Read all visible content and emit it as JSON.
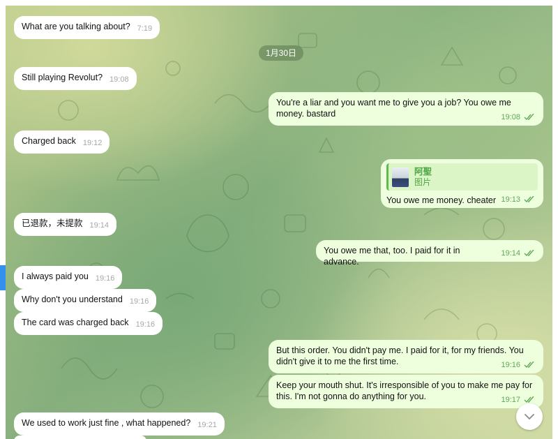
{
  "date_divider": "1月30日",
  "incoming": [
    {
      "text": "What are you talking about?",
      "time": "7:19"
    },
    {
      "text": "Still playing Revolut?",
      "time": "19:08"
    },
    {
      "text": "Charged back",
      "time": "19:12"
    },
    {
      "text": "已退款，未提款",
      "time": "19:14"
    },
    {
      "text": "I always paid you",
      "time": "19:16"
    },
    {
      "text": "Why don't you understand",
      "time": "19:16"
    },
    {
      "text": "The card was charged back",
      "time": "19:16"
    },
    {
      "text": "We used to work just fine , what happened?",
      "time": "19:21"
    }
  ],
  "outgoing": [
    {
      "text": "You're a liar and you want me to give you a job? You owe me money. bastard",
      "time": "19:08"
    },
    {
      "text": "You owe me money. cheater",
      "time": "19:13",
      "reply_name": "阿聖",
      "reply_sub": "图片"
    },
    {
      "text": "You owe me that, too. I paid for it in advance.",
      "time": "19:14"
    },
    {
      "text": "But this order. You didn't pay me. I paid for it, for my friends. You didn't give it to me the first time.",
      "time": "19:16"
    },
    {
      "text": "Keep your mouth shut. It's irresponsible of you to make me pay for this. I'm not gonna do anything for you.",
      "time": "19:17"
    }
  ],
  "colors": {
    "incoming_bubble": "#ffffff",
    "outgoing_bubble": "#eeffde",
    "read_checks": "#5fa65a",
    "reply_accent": "#5fba53"
  },
  "icons": {
    "scroll_down": "chevron-down-icon",
    "read_receipt": "double-check-icon"
  }
}
